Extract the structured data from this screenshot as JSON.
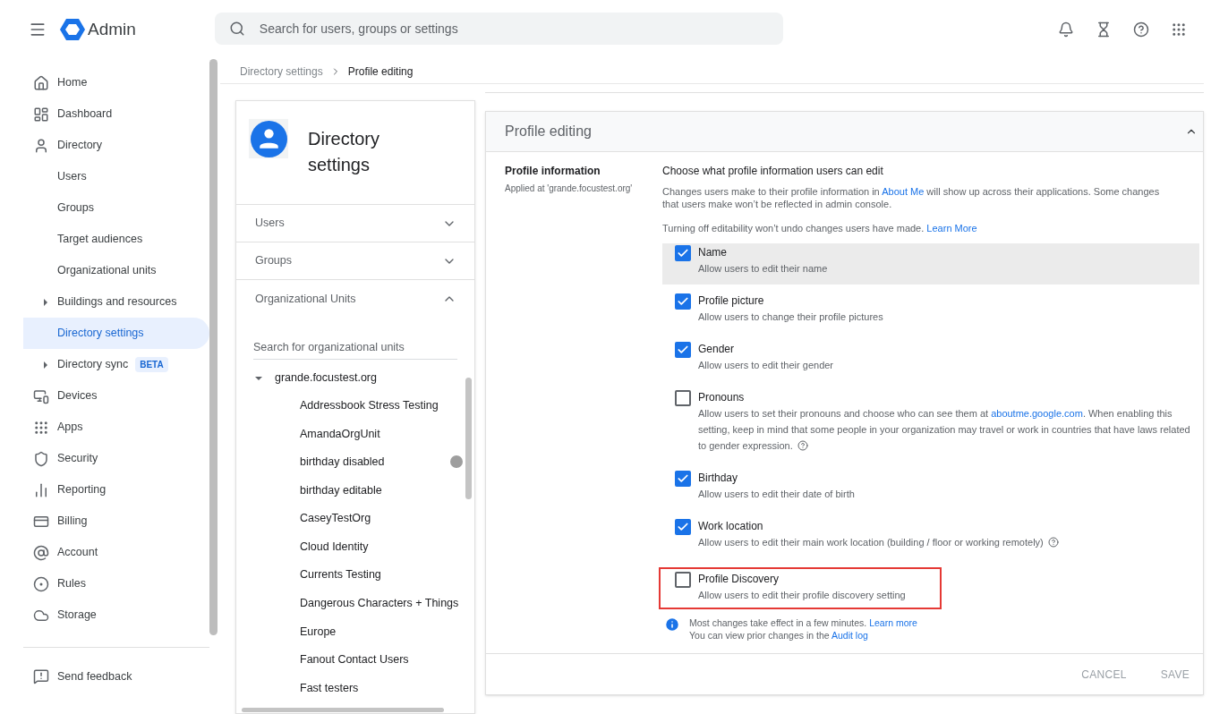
{
  "header": {
    "app_name": "Admin",
    "search": {
      "placeholder": "Search for users, groups or settings"
    }
  },
  "sidebar": {
    "items": [
      {
        "label": "Home",
        "kind": "section",
        "selected": false
      },
      {
        "label": "Dashboard",
        "kind": "section",
        "selected": false
      },
      {
        "label": "Directory",
        "kind": "section",
        "selected": false
      },
      {
        "label": "Users",
        "kind": "sub",
        "selected": false
      },
      {
        "label": "Groups",
        "kind": "sub",
        "selected": false
      },
      {
        "label": "Target audiences",
        "kind": "sub",
        "selected": false
      },
      {
        "label": "Organizational units",
        "kind": "sub",
        "selected": false
      },
      {
        "label": "Buildings and resources",
        "kind": "expandable",
        "selected": false
      },
      {
        "label": "Directory settings",
        "kind": "sub",
        "selected": true
      },
      {
        "label": "Directory sync",
        "kind": "expandable",
        "selected": false,
        "badge": "BETA"
      },
      {
        "label": "Devices",
        "kind": "section",
        "selected": false
      },
      {
        "label": "Apps",
        "kind": "section",
        "selected": false
      },
      {
        "label": "Security",
        "kind": "section",
        "selected": false
      },
      {
        "label": "Reporting",
        "kind": "section",
        "selected": false
      },
      {
        "label": "Billing",
        "kind": "section",
        "selected": false
      },
      {
        "label": "Account",
        "kind": "section",
        "selected": false
      },
      {
        "label": "Rules",
        "kind": "section",
        "selected": false
      },
      {
        "label": "Storage",
        "kind": "section",
        "selected": false
      }
    ],
    "footer": "Send feedback"
  },
  "breadcrumb": [
    "Directory settings",
    "Profile editing"
  ],
  "settings_card": {
    "title": "Directory settings",
    "sections": [
      {
        "label": "Users",
        "expanded": false
      },
      {
        "label": "Groups",
        "expanded": false
      },
      {
        "label": "Organizational Units",
        "expanded": true
      }
    ],
    "search": {
      "placeholder": "Search for organizational units"
    },
    "tree": {
      "label": "grande.focustest.org",
      "expanded": true,
      "children": [
        {
          "label": "Addressbook Stress Testing",
          "status_dot": false
        },
        {
          "label": "AmandaOrgUnit",
          "status_dot": false
        },
        {
          "label": "birthday disabled",
          "status_dot": true
        },
        {
          "label": "birthday editable",
          "status_dot": false
        },
        {
          "label": "CaseyTestOrg",
          "status_dot": false
        },
        {
          "label": "Cloud Identity",
          "status_dot": false
        },
        {
          "label": "Currents Testing",
          "status_dot": false
        },
        {
          "label": "Dangerous Characters + Things",
          "status_dot": false
        },
        {
          "label": "Europe",
          "status_dot": false
        },
        {
          "label": "Fanout Contact Users",
          "status_dot": false
        },
        {
          "label": "Fast testers",
          "status_dot": false
        }
      ]
    }
  },
  "panel": {
    "title": "Profile editing",
    "expanded": true,
    "section_label": "Profile information",
    "applied_at": "Applied at 'grande.focustest.org'",
    "heading": "Choose what profile information users can edit",
    "intro": [
      {
        "kind": "text",
        "text": "Changes users make to their profile information in "
      },
      {
        "kind": "link",
        "text": "About Me"
      },
      {
        "kind": "text",
        "text": " will show up across their applications. Some changes that users make won’t be reflected in admin console."
      }
    ],
    "note": [
      {
        "kind": "text",
        "text": "Turning off editability won’t undo changes users have made. "
      },
      {
        "kind": "link",
        "text": "Learn More"
      }
    ],
    "options": [
      {
        "label": "Name",
        "checked": true,
        "highlighted": true,
        "outlined": false,
        "help": false,
        "description": [
          {
            "kind": "text",
            "text": "Allow users to edit their name"
          }
        ]
      },
      {
        "label": "Profile picture",
        "checked": true,
        "highlighted": false,
        "outlined": false,
        "help": false,
        "description": [
          {
            "kind": "text",
            "text": "Allow users to change their profile pictures"
          }
        ]
      },
      {
        "label": "Gender",
        "checked": true,
        "highlighted": false,
        "outlined": false,
        "help": false,
        "description": [
          {
            "kind": "text",
            "text": "Allow users to edit their gender"
          }
        ]
      },
      {
        "label": "Pronouns",
        "checked": false,
        "highlighted": false,
        "outlined": false,
        "help": true,
        "description": [
          {
            "kind": "text",
            "text": "Allow users to set their pronouns and choose who can see them at "
          },
          {
            "kind": "link",
            "text": "aboutme.google.com"
          },
          {
            "kind": "text",
            "text": ". When enabling this setting, keep in mind that some people in your organization may travel or work in countries that have laws related to gender expression."
          }
        ]
      },
      {
        "label": "Birthday",
        "checked": true,
        "highlighted": false,
        "outlined": false,
        "help": false,
        "description": [
          {
            "kind": "text",
            "text": "Allow users to edit their date of birth"
          }
        ]
      },
      {
        "label": "Work location",
        "checked": true,
        "highlighted": false,
        "outlined": false,
        "help": true,
        "description": [
          {
            "kind": "text",
            "text": "Allow users to edit their main work location (building / floor or working remotely)"
          }
        ]
      },
      {
        "label": "Profile Discovery",
        "checked": false,
        "highlighted": false,
        "outlined": true,
        "help": false,
        "description": [
          {
            "kind": "text",
            "text": "Allow users to edit their profile discovery setting"
          }
        ]
      }
    ],
    "info": [
      [
        {
          "kind": "text",
          "text": "Most changes take effect in a few minutes. "
        },
        {
          "kind": "link",
          "text": "Learn more"
        }
      ],
      [
        {
          "kind": "text",
          "text": "You can view prior changes in the "
        },
        {
          "kind": "link",
          "text": "Audit log"
        }
      ]
    ],
    "buttons": [
      "CANCEL",
      "SAVE"
    ]
  }
}
